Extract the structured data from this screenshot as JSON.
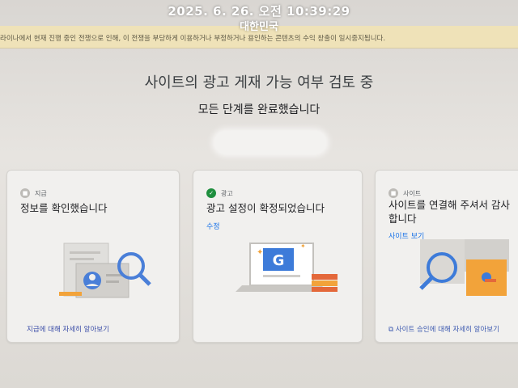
{
  "stamp": {
    "timestamp": "2025. 6. 26. 오전 10:39:29",
    "location": "대한민국"
  },
  "notice": {
    "text": "라이나에서 현재 진행 중인 전쟁으로 인해, 이 전쟁을 부당하게 이용하거나 부정하거나 용인하는 콘텐츠의 수익 창출이 일시중지됩니다."
  },
  "header": {
    "title": "사이트의 광고 게재 가능 여부 검토 중",
    "subtitle": "모든 단계를 완료했습니다"
  },
  "cards": [
    {
      "category": "지급",
      "title": "정보를 확인했습니다",
      "bottom_link": "지급에 대해 자세히 알아보기"
    },
    {
      "category": "광고",
      "title": "광고 설정이 확정되었습니다",
      "link": "수정"
    },
    {
      "category": "사이트",
      "title": "사이트를 연결해 주셔서 감사합니다",
      "link": "사이트 보기",
      "bottom_link": "사이트 승인에 대해 자세히 알아보기"
    }
  ],
  "icons": {
    "payments_illustration": "document-magnifier-icon",
    "ads_illustration": "laptop-google-icon",
    "site_illustration": "puzzle-magnifier-icon"
  },
  "colors": {
    "accent": "#1a73e8",
    "success": "#1e8e3e",
    "notice_bg": "#efe2b8"
  }
}
